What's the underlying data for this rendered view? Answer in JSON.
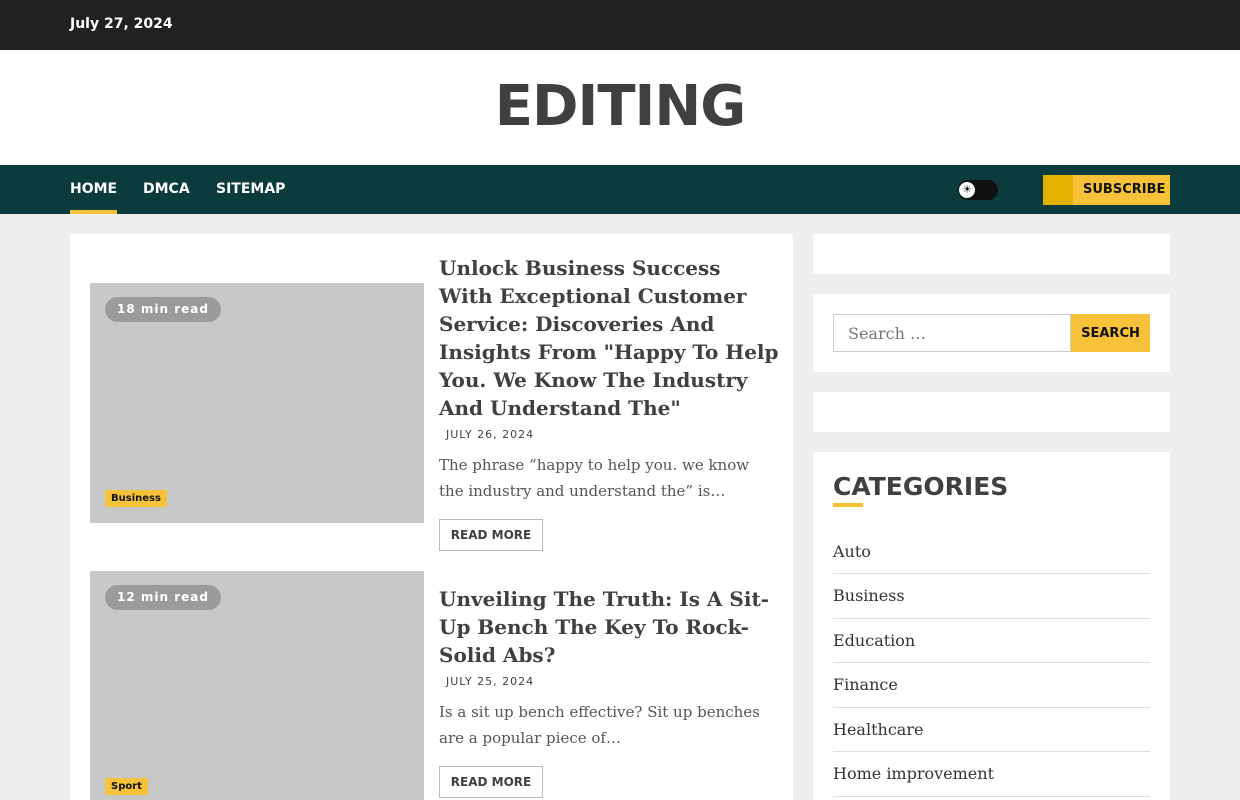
{
  "topbar": {
    "date": "July 27, 2024"
  },
  "site": {
    "title": "EDITING"
  },
  "nav": {
    "items": [
      {
        "label": "HOME"
      },
      {
        "label": "DMCA"
      },
      {
        "label": "SITEMAP"
      }
    ],
    "subscribe_label": "SUBSCRIBE"
  },
  "posts": [
    {
      "read_time": "18 min read",
      "category": "Business",
      "title": "Unlock Business Success With Exceptional Customer Service: Discoveries And Insights From \"Happy To Help You. We Know The Industry And Understand The\"",
      "date": "JULY 26, 2024",
      "excerpt": "The phrase “happy to help you. we know the industry and understand the” is…",
      "read_more": "READ MORE"
    },
    {
      "read_time": "12 min read",
      "category": "Sport",
      "title": "Unveiling The Truth: Is A Sit-Up Bench The Key To Rock-Solid Abs?",
      "date": "JULY 25, 2024",
      "excerpt": "Is a sit up bench effective? Sit up benches are a popular piece of…",
      "read_more": "READ MORE"
    }
  ],
  "sidebar": {
    "search": {
      "placeholder": "Search …",
      "button": "SEARCH"
    },
    "categories": {
      "heading": "CATEGORIES",
      "items": [
        "Auto",
        "Business",
        "Education",
        "Finance",
        "Healthcare",
        "Home improvement"
      ]
    }
  },
  "colors": {
    "accent": "#f5c23a",
    "nav_bg": "#0b3b3c",
    "topbar_bg": "#212121"
  }
}
